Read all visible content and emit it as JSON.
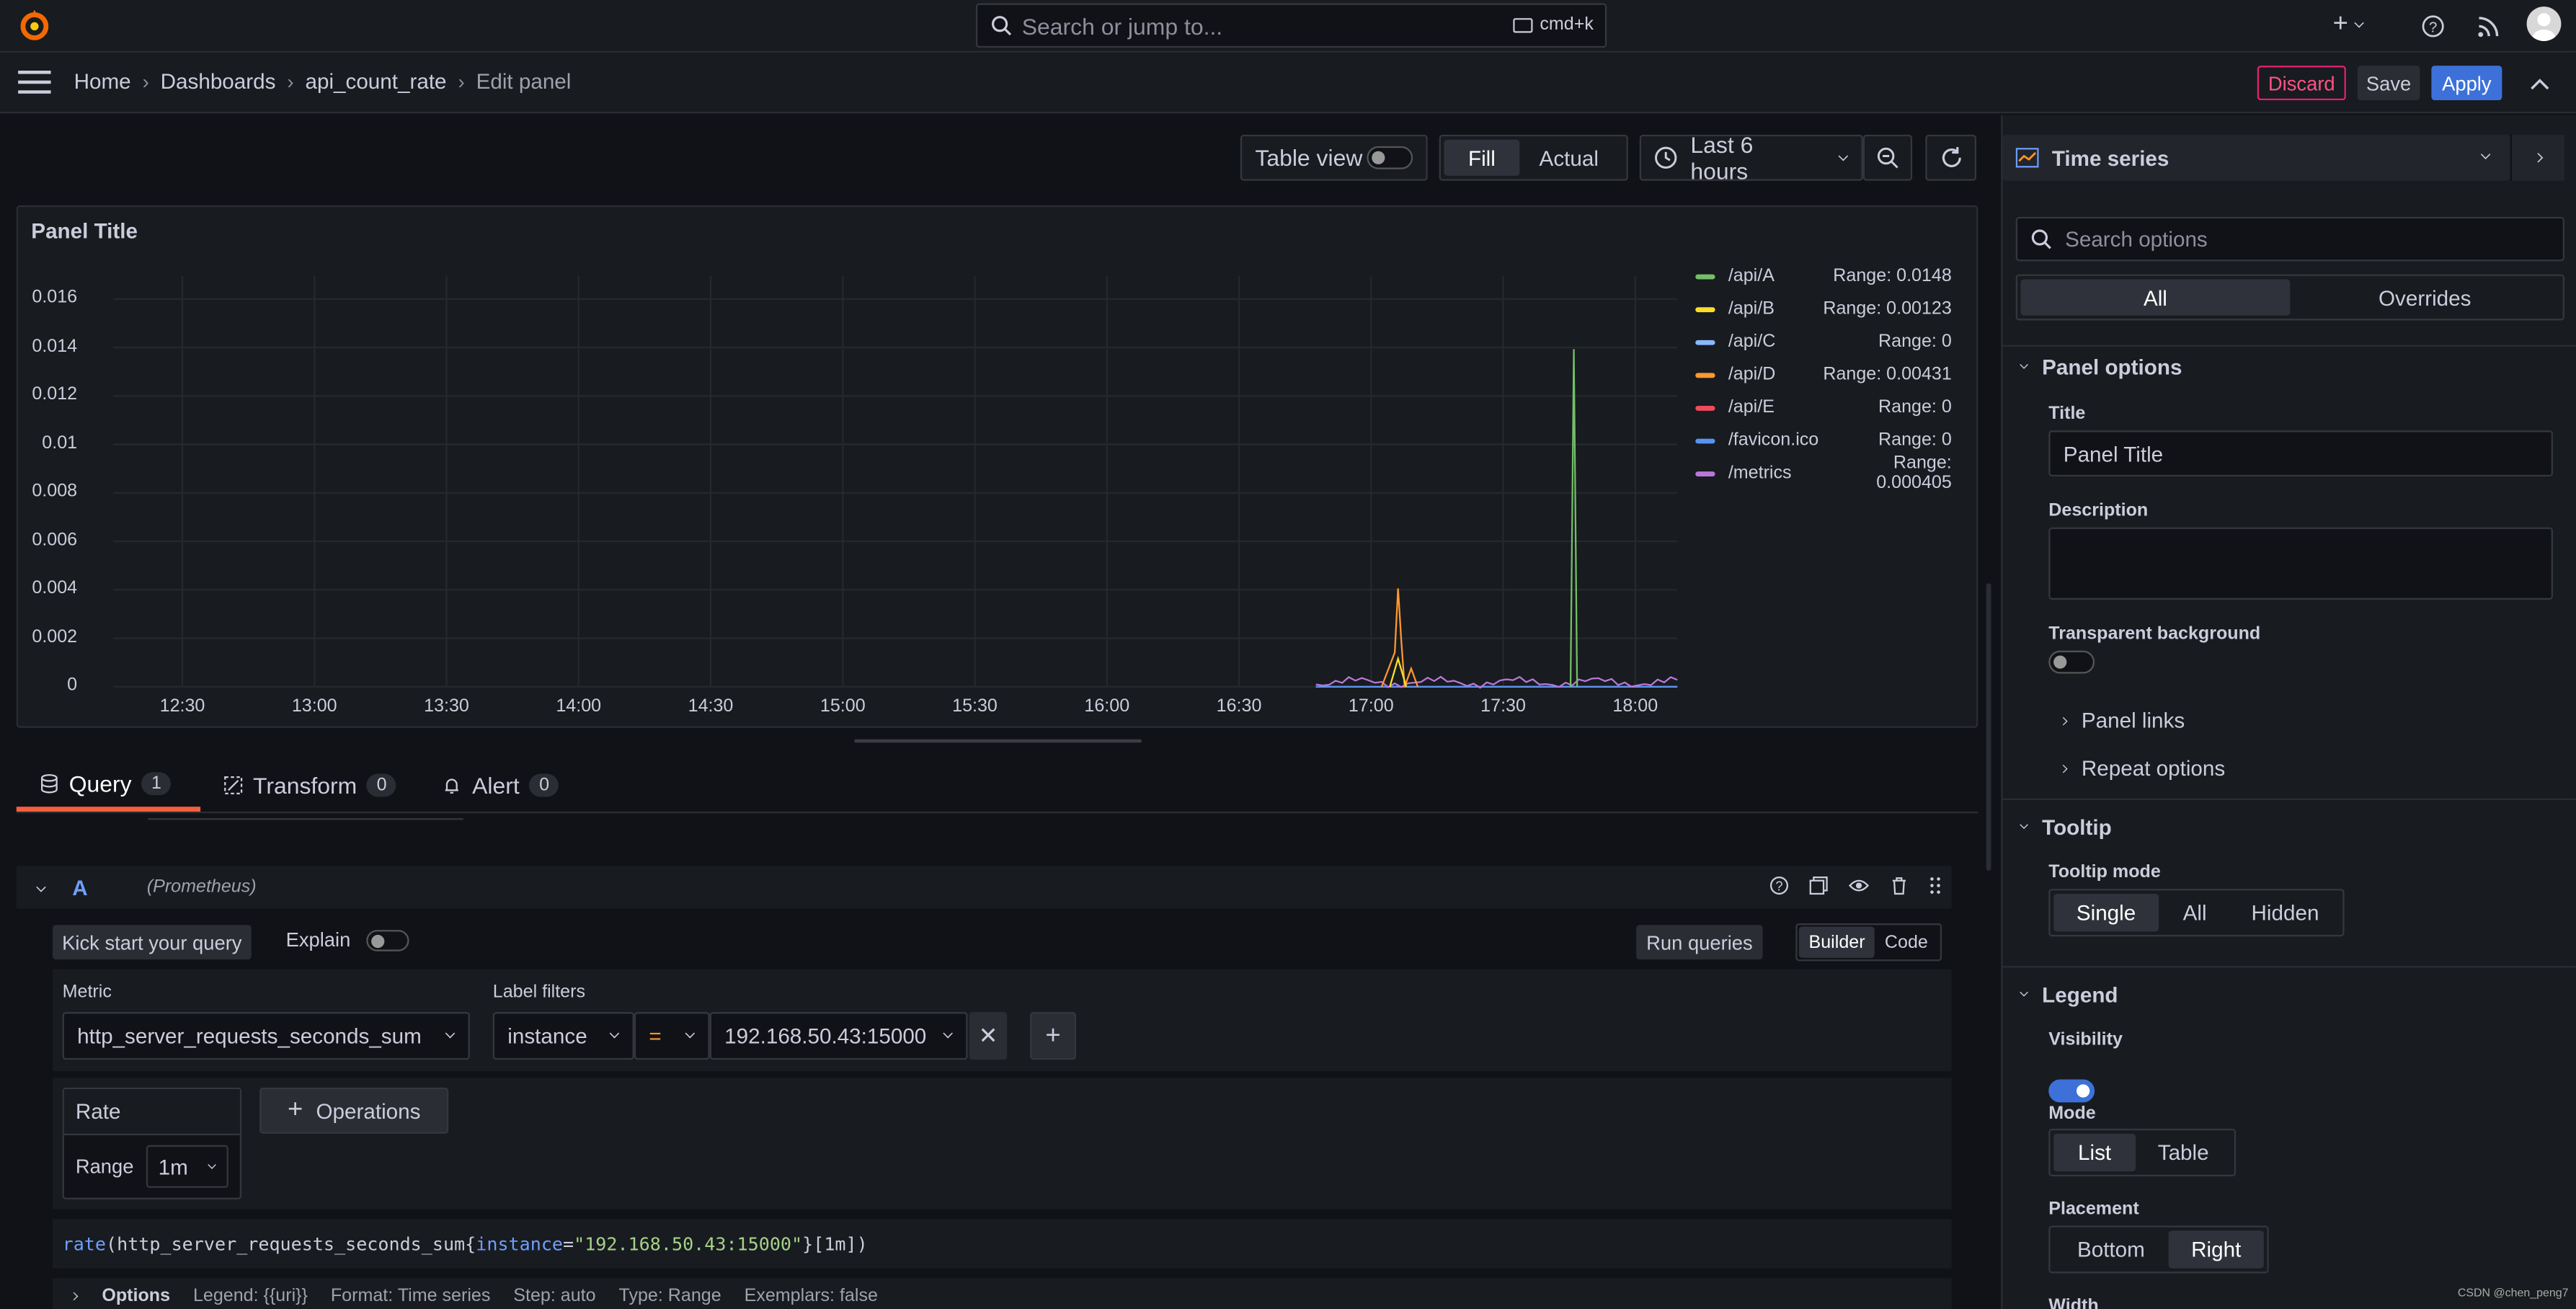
{
  "topbar": {
    "search_placeholder": "Search or jump to...",
    "shortcut": "cmd+k"
  },
  "breadcrumb": [
    "Home",
    "Dashboards",
    "api_count_rate",
    "Edit panel"
  ],
  "actions": {
    "discard": "Discard",
    "save": "Save",
    "apply": "Apply"
  },
  "toolbar": {
    "table_view": "Table view",
    "fill": "Fill",
    "actual": "Actual",
    "time_range": "Last 6 hours"
  },
  "panel": {
    "title": "Panel Title"
  },
  "chart_data": {
    "type": "line",
    "title": "Panel Title",
    "y_ticks": [
      "0.016",
      "0.014",
      "0.012",
      "0.01",
      "0.008",
      "0.006",
      "0.004",
      "0.002",
      "0"
    ],
    "x_ticks": [
      "12:30",
      "13:00",
      "13:30",
      "14:00",
      "14:30",
      "15:00",
      "15:30",
      "16:00",
      "16:30",
      "17:00",
      "17:30",
      "18:00"
    ],
    "ylim": [
      0,
      0.017
    ],
    "legend_placement": "right",
    "series": [
      {
        "name": "/api/A",
        "color": "#73bf69",
        "range": "Range: 0.0148"
      },
      {
        "name": "/api/B",
        "color": "#fade2a",
        "range": "Range: 0.00123"
      },
      {
        "name": "/api/C",
        "color": "#8ab8ff",
        "range": "Range: 0"
      },
      {
        "name": "/api/D",
        "color": "#ff9830",
        "range": "Range: 0.00431"
      },
      {
        "name": "/api/E",
        "color": "#f2495c",
        "range": "Range: 0"
      },
      {
        "name": "/favicon.ico",
        "color": "#5794f2",
        "range": "Range: 0"
      },
      {
        "name": "/metrics",
        "color": "#b877d9",
        "range": "Range: 0.000405"
      }
    ]
  },
  "tabs": [
    {
      "label": "Query",
      "count": "1"
    },
    {
      "label": "Transform",
      "count": "0"
    },
    {
      "label": "Alert",
      "count": "0"
    }
  ],
  "query": {
    "ref": "A",
    "datasource": "(Prometheus)",
    "kick_start": "Kick start your query",
    "explain": "Explain",
    "run_queries": "Run queries",
    "builder": "Builder",
    "code": "Code",
    "metric_label": "Metric",
    "metric_value": "http_server_requests_seconds_sum",
    "label_filters": "Label filters",
    "filter_label": "instance",
    "filter_op": "=",
    "filter_value": "192.168.50.43:15000",
    "op_name": "Rate",
    "range_label": "Range",
    "range_value": "1m",
    "operations": "Operations",
    "promql_fn": "rate",
    "promql_metric": "http_server_requests_seconds_sum",
    "promql_label": "instance",
    "promql_value": "\"192.168.50.43:15000\"",
    "promql_range": "[1m]",
    "options": "Options",
    "legend_info": "Legend: {{uri}}",
    "format_info": "Format: Time series",
    "step_info": "Step: auto",
    "type_info": "Type: Range",
    "exemplars_info": "Exemplars: false"
  },
  "options_pane": {
    "viz": "Time series",
    "search_placeholder": "Search options",
    "all": "All",
    "overrides": "Overrides",
    "panel_options": "Panel options",
    "title_label": "Title",
    "title_value": "Panel Title",
    "description_label": "Description",
    "transparent_label": "Transparent background",
    "panel_links": "Panel links",
    "repeat_options": "Repeat options",
    "tooltip": "Tooltip",
    "tooltip_mode": "Tooltip mode",
    "tooltip_opts": [
      "Single",
      "All",
      "Hidden"
    ],
    "legend": "Legend",
    "visibility": "Visibility",
    "mode": "Mode",
    "mode_opts": [
      "List",
      "Table"
    ],
    "placement": "Placement",
    "placement_opts": [
      "Bottom",
      "Right"
    ],
    "width": "Width"
  },
  "watermark": "CSDN @chen_peng7"
}
